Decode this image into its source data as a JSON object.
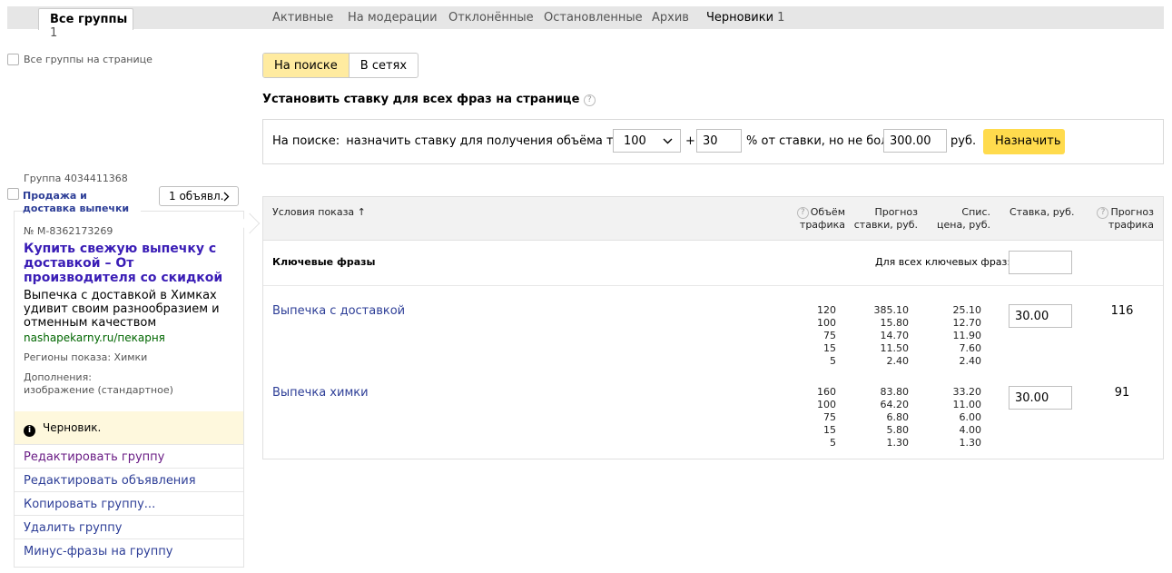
{
  "tabs": {
    "active": {
      "label": "Все группы",
      "count": "1"
    },
    "items": [
      {
        "label": "Активные"
      },
      {
        "label": "На модерации"
      },
      {
        "label": "Отклонённые"
      },
      {
        "label": "Остановленные"
      },
      {
        "label": "Архив"
      },
      {
        "label": "Черновики",
        "count": "1"
      }
    ]
  },
  "select_all_label": "Все группы на странице",
  "mode": {
    "search": "На поиске",
    "networks": "В сетях"
  },
  "bid_all": {
    "title": "Установить ставку для всех фраз на странице",
    "help": "?",
    "prefix": "На поиске:",
    "text": "назначить ставку для получения объёма трафика",
    "traffic_value": "100",
    "plus": "+",
    "percent_value": "30",
    "percent_text": "% от ставки, но не более",
    "max_value": "300.00",
    "currency": "руб.",
    "apply": "Назначить"
  },
  "group": {
    "id_label": "Группа 4034411368",
    "name": "Продажа и доставка выпечки",
    "ads_button": "1 объявл.",
    "ad_number": "№ M-8362173269",
    "ad_title": "Купить свежую выпечку с доставкой – От производителя со скидкой",
    "ad_text": "Выпечка с доставкой в Химках удивит своим разнообразием и отменным качеством",
    "ad_url": "nashapekarny.ru/пекарня",
    "regions": "Регионы показа: Химки",
    "extras_label": "Дополнения:",
    "extras_value": "изображение (стандартное)",
    "status": "Черновик.",
    "status_icon": "info-icon",
    "actions": [
      "Редактировать группу",
      "Редактировать объявления",
      "Копировать группу...",
      "Удалить группу",
      "Минус-фразы на группу"
    ]
  },
  "table": {
    "headers": {
      "conditions": "Условия показа ↑",
      "traffic_1": "Объём",
      "traffic_2": "трафика",
      "forecast_1": "Прогноз",
      "forecast_2": "ставки, руб.",
      "spend_1": "Спис.",
      "spend_2": "цена, руб.",
      "bid": "Ставка, руб.",
      "forecast_traffic_1": "Прогноз",
      "forecast_traffic_2": "трафика"
    },
    "keywords_label": "Ключевые фразы",
    "for_all_label": "Для всех ключевых фраз:",
    "rows": [
      {
        "phrase": "Выпечка с доставкой",
        "traffic": [
          "120",
          "100",
          "75",
          "15",
          "5"
        ],
        "forecast": [
          "385.10",
          "15.80",
          "14.70",
          "11.50",
          "2.40"
        ],
        "spend": [
          "25.10",
          "12.70",
          "11.90",
          "7.60",
          "2.40"
        ],
        "bid": "30.00",
        "forecast_traffic": "116"
      },
      {
        "phrase": "Выпечка химки",
        "traffic": [
          "160",
          "100",
          "75",
          "15",
          "5"
        ],
        "forecast": [
          "83.80",
          "64.20",
          "6.80",
          "5.80",
          "1.30"
        ],
        "spend": [
          "33.20",
          "11.00",
          "6.00",
          "4.00",
          "1.30"
        ],
        "bid": "30.00",
        "forecast_traffic": "91"
      }
    ]
  }
}
